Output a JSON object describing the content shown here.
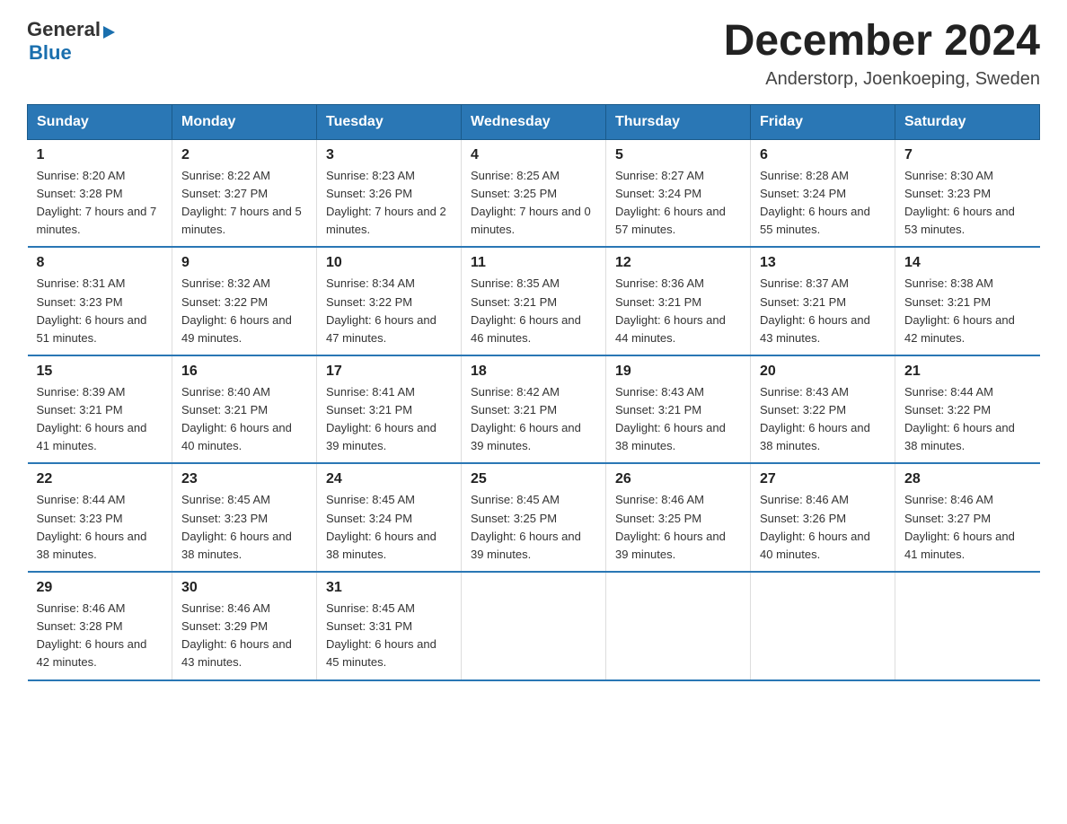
{
  "logo": {
    "general": "General",
    "arrow": "▶",
    "blue": "Blue"
  },
  "title": "December 2024",
  "location": "Anderstorp, Joenkoeping, Sweden",
  "days_header": [
    "Sunday",
    "Monday",
    "Tuesday",
    "Wednesday",
    "Thursday",
    "Friday",
    "Saturday"
  ],
  "weeks": [
    [
      {
        "day": "1",
        "sunrise": "8:20 AM",
        "sunset": "3:28 PM",
        "daylight": "7 hours and 7 minutes."
      },
      {
        "day": "2",
        "sunrise": "8:22 AM",
        "sunset": "3:27 PM",
        "daylight": "7 hours and 5 minutes."
      },
      {
        "day": "3",
        "sunrise": "8:23 AM",
        "sunset": "3:26 PM",
        "daylight": "7 hours and 2 minutes."
      },
      {
        "day": "4",
        "sunrise": "8:25 AM",
        "sunset": "3:25 PM",
        "daylight": "7 hours and 0 minutes."
      },
      {
        "day": "5",
        "sunrise": "8:27 AM",
        "sunset": "3:24 PM",
        "daylight": "6 hours and 57 minutes."
      },
      {
        "day": "6",
        "sunrise": "8:28 AM",
        "sunset": "3:24 PM",
        "daylight": "6 hours and 55 minutes."
      },
      {
        "day": "7",
        "sunrise": "8:30 AM",
        "sunset": "3:23 PM",
        "daylight": "6 hours and 53 minutes."
      }
    ],
    [
      {
        "day": "8",
        "sunrise": "8:31 AM",
        "sunset": "3:23 PM",
        "daylight": "6 hours and 51 minutes."
      },
      {
        "day": "9",
        "sunrise": "8:32 AM",
        "sunset": "3:22 PM",
        "daylight": "6 hours and 49 minutes."
      },
      {
        "day": "10",
        "sunrise": "8:34 AM",
        "sunset": "3:22 PM",
        "daylight": "6 hours and 47 minutes."
      },
      {
        "day": "11",
        "sunrise": "8:35 AM",
        "sunset": "3:21 PM",
        "daylight": "6 hours and 46 minutes."
      },
      {
        "day": "12",
        "sunrise": "8:36 AM",
        "sunset": "3:21 PM",
        "daylight": "6 hours and 44 minutes."
      },
      {
        "day": "13",
        "sunrise": "8:37 AM",
        "sunset": "3:21 PM",
        "daylight": "6 hours and 43 minutes."
      },
      {
        "day": "14",
        "sunrise": "8:38 AM",
        "sunset": "3:21 PM",
        "daylight": "6 hours and 42 minutes."
      }
    ],
    [
      {
        "day": "15",
        "sunrise": "8:39 AM",
        "sunset": "3:21 PM",
        "daylight": "6 hours and 41 minutes."
      },
      {
        "day": "16",
        "sunrise": "8:40 AM",
        "sunset": "3:21 PM",
        "daylight": "6 hours and 40 minutes."
      },
      {
        "day": "17",
        "sunrise": "8:41 AM",
        "sunset": "3:21 PM",
        "daylight": "6 hours and 39 minutes."
      },
      {
        "day": "18",
        "sunrise": "8:42 AM",
        "sunset": "3:21 PM",
        "daylight": "6 hours and 39 minutes."
      },
      {
        "day": "19",
        "sunrise": "8:43 AM",
        "sunset": "3:21 PM",
        "daylight": "6 hours and 38 minutes."
      },
      {
        "day": "20",
        "sunrise": "8:43 AM",
        "sunset": "3:22 PM",
        "daylight": "6 hours and 38 minutes."
      },
      {
        "day": "21",
        "sunrise": "8:44 AM",
        "sunset": "3:22 PM",
        "daylight": "6 hours and 38 minutes."
      }
    ],
    [
      {
        "day": "22",
        "sunrise": "8:44 AM",
        "sunset": "3:23 PM",
        "daylight": "6 hours and 38 minutes."
      },
      {
        "day": "23",
        "sunrise": "8:45 AM",
        "sunset": "3:23 PM",
        "daylight": "6 hours and 38 minutes."
      },
      {
        "day": "24",
        "sunrise": "8:45 AM",
        "sunset": "3:24 PM",
        "daylight": "6 hours and 38 minutes."
      },
      {
        "day": "25",
        "sunrise": "8:45 AM",
        "sunset": "3:25 PM",
        "daylight": "6 hours and 39 minutes."
      },
      {
        "day": "26",
        "sunrise": "8:46 AM",
        "sunset": "3:25 PM",
        "daylight": "6 hours and 39 minutes."
      },
      {
        "day": "27",
        "sunrise": "8:46 AM",
        "sunset": "3:26 PM",
        "daylight": "6 hours and 40 minutes."
      },
      {
        "day": "28",
        "sunrise": "8:46 AM",
        "sunset": "3:27 PM",
        "daylight": "6 hours and 41 minutes."
      }
    ],
    [
      {
        "day": "29",
        "sunrise": "8:46 AM",
        "sunset": "3:28 PM",
        "daylight": "6 hours and 42 minutes."
      },
      {
        "day": "30",
        "sunrise": "8:46 AM",
        "sunset": "3:29 PM",
        "daylight": "6 hours and 43 minutes."
      },
      {
        "day": "31",
        "sunrise": "8:45 AM",
        "sunset": "3:31 PM",
        "daylight": "6 hours and 45 minutes."
      },
      null,
      null,
      null,
      null
    ]
  ]
}
